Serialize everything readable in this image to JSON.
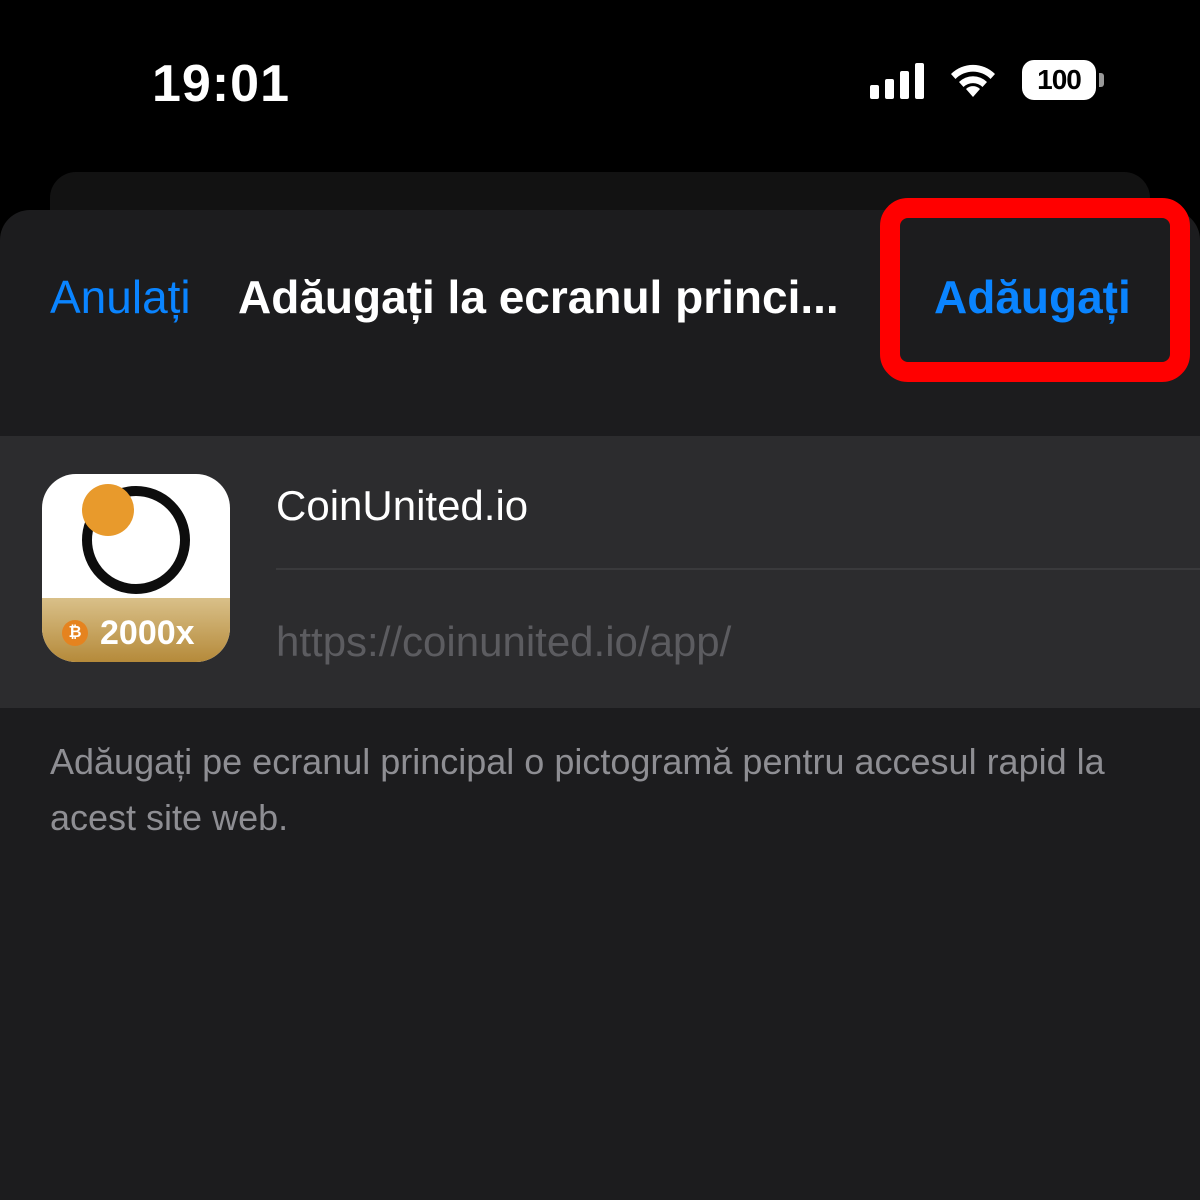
{
  "status_bar": {
    "time": "19:01",
    "battery": "100",
    "icons": [
      "signal-icon",
      "wifi-icon",
      "battery-icon"
    ]
  },
  "nav": {
    "cancel_label": "Anulați",
    "title": "Adăugați la ecranul princi...",
    "add_label": "Adăugați"
  },
  "app": {
    "icon_badge": "2000x",
    "coin_glyph": "₿",
    "name": "CoinUnited.io",
    "url": "https://coinunited.io/app/"
  },
  "description": "Adăugați pe ecranul principal o pictogramă pentru accesul rapid la acest site web.",
  "colors": {
    "accent": "#0a84ff",
    "highlight": "#ff0000",
    "sheet_bg": "#1c1c1e",
    "group_bg": "#2c2c2e"
  }
}
